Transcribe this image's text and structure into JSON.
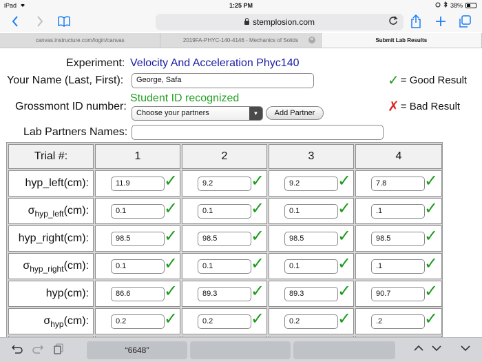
{
  "status": {
    "device": "iPad",
    "time": "1:25 PM",
    "battery": "38%"
  },
  "browser": {
    "url": "stemplosion.com",
    "icons": [
      "back-icon",
      "forward-icon",
      "bookmarks-icon",
      "lock-icon",
      "reload-icon",
      "share-icon",
      "new-tab-icon",
      "tabs-icon"
    ]
  },
  "tabs": [
    {
      "label": "canvas.instructure.com/login/canvas"
    },
    {
      "label": "2019FA-PHYC-140-4146 - Mechanics of Solids"
    },
    {
      "label": "Submit Lab Results"
    }
  ],
  "form": {
    "experiment_label": "Experiment:",
    "experiment_value": "Velocity And Acceleration Phyc140",
    "name_label": "Your Name (Last, First):",
    "name_value": "George, Safa",
    "id_label": "Grossmont ID number:",
    "id_status": "Student ID recognized",
    "partners_select": "Choose your partners",
    "add_partner": "Add Partner",
    "lab_partners_label": "Lab Partners Names:",
    "lab_partners_value": ""
  },
  "legend": {
    "good": "= Good Result",
    "bad": "= Bad Result",
    "good_color": "#1a9a1a",
    "bad_color": "#e02020"
  },
  "table": {
    "header_label": "Trial #:",
    "trials": [
      "1",
      "2",
      "3",
      "4"
    ],
    "rows": [
      {
        "label": "hyp_left(cm):",
        "values": [
          "11.9",
          "9.2",
          "9.2",
          "7.8"
        ]
      },
      {
        "label_main": "σ",
        "label_sub": "hyp_left",
        "label_tail": "(cm):",
        "values": [
          "0.1",
          "0.1",
          "0.1",
          ".1"
        ]
      },
      {
        "label": "hyp_right(cm):",
        "values": [
          "98.5",
          "98.5",
          "98.5",
          "98.5"
        ]
      },
      {
        "label_main": "σ",
        "label_sub": "hyp_right",
        "label_tail": "(cm):",
        "values": [
          "0.1",
          "0.1",
          "0.1",
          ".1"
        ]
      },
      {
        "label": "hyp(cm):",
        "values": [
          "86.6",
          "89.3",
          "89.3",
          "90.7"
        ]
      },
      {
        "label_main": "σ",
        "label_sub": "hyp",
        "label_tail": "(cm):",
        "values": [
          "0.2",
          "0.2",
          "0.2",
          ".2"
        ]
      }
    ]
  },
  "keyboard": {
    "suggestion": "“6648”",
    "icons": [
      "undo-icon",
      "redo-icon",
      "paste-icon",
      "chevron-up-icon",
      "chevron-down-icon",
      "dismiss-keyboard-icon"
    ]
  }
}
